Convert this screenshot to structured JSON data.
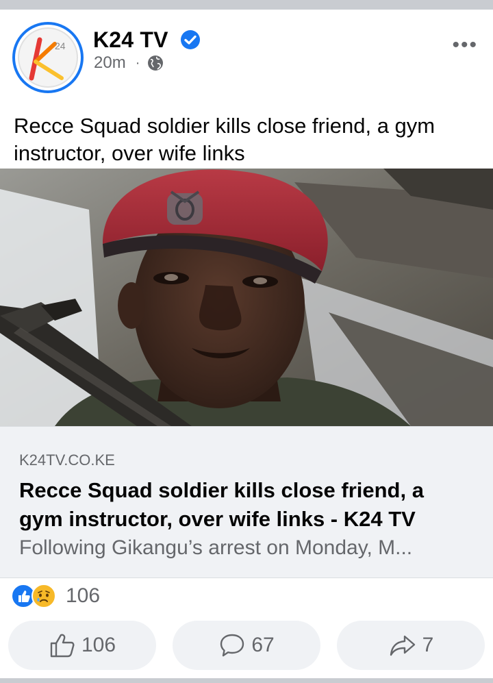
{
  "post": {
    "page_name": "K24 TV",
    "time": "20m",
    "audience_icon": "globe-icon",
    "verified_icon": "verified-badge-icon",
    "more_icon": "more-options-icon",
    "more_label": "•••",
    "caption": "Recce Squad soldier kills close friend, a gym instructor, over wife links",
    "logo_text": "24"
  },
  "link_preview": {
    "domain": "K24TV.CO.KE",
    "title": "Recce Squad soldier kills close friend, a gym instructor, over wife links - K24 TV",
    "description": "Following Gikangu’s arrest on Monday, M..."
  },
  "reactions": {
    "icons": [
      "like-reaction-icon",
      "sad-reaction-icon"
    ],
    "count": "106"
  },
  "actions": {
    "like_count": "106",
    "comment_count": "67",
    "share_count": "7"
  },
  "colors": {
    "brand_blue": "#1877f2",
    "secondary_text": "#65676b",
    "card_background": "#f0f2f5"
  }
}
